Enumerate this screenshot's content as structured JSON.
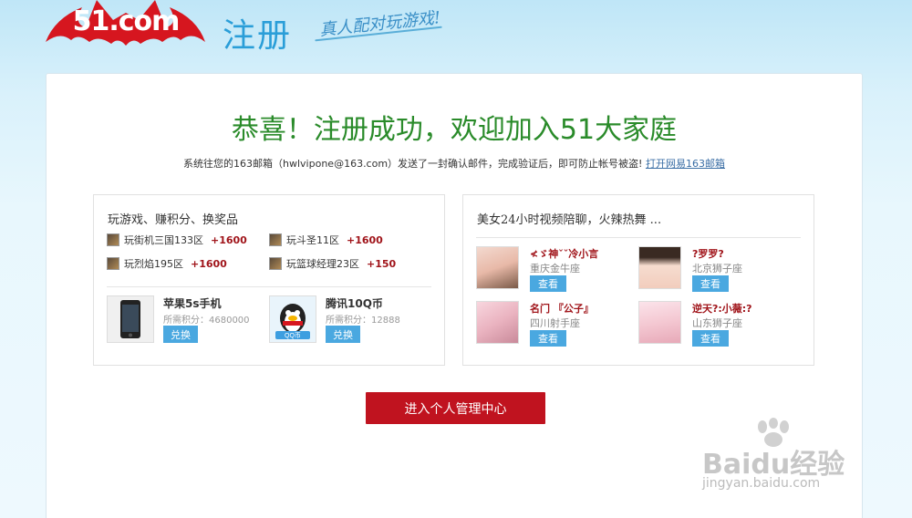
{
  "header": {
    "logo": "51.com",
    "register_title": "注册",
    "slogan": "真人配对玩游戏!"
  },
  "main": {
    "success_title": "恭喜！注册成功，欢迎加入51大家庭",
    "verify_text": "系统往您的163邮箱（hwlvipone@163.com）发送了一封确认邮件，完成验证后，即可防止帐号被盗!",
    "verify_link": "打开网易163邮箱"
  },
  "games_panel": {
    "title": "玩游戏、赚积分、换奖品",
    "games": [
      {
        "name": "玩街机三国133区",
        "points": "+1600"
      },
      {
        "name": "玩斗圣11区",
        "points": "+1600"
      },
      {
        "name": "玩烈焰195区",
        "points": "+1600"
      },
      {
        "name": "玩篮球经理23区",
        "points": "+150"
      }
    ],
    "prizes": [
      {
        "name": "苹果5s手机",
        "cost": "所需积分：4680000",
        "button": "兑换"
      },
      {
        "name": "腾讯10Q币",
        "cost": "所需积分：12888",
        "button": "兑换",
        "image_text": "QQ币"
      }
    ]
  },
  "video_panel": {
    "title": "美女24小时视频陪聊，火辣热舞 ...",
    "girls": [
      {
        "nick": "≮ゞ神ˇˇ冷小言",
        "location": "重庆金牛座",
        "button": "查看"
      },
      {
        "nick": "?罗罗?",
        "location": "北京狮子座",
        "button": "查看"
      },
      {
        "nick": "名门 『公子』",
        "location": "四川射手座",
        "button": "查看"
      },
      {
        "nick": "逆天?:小薇:?",
        "location": "山东狮子座",
        "button": "查看"
      }
    ]
  },
  "enter_button": "进入个人管理中心",
  "watermark": {
    "brand": "Baidu经验",
    "url": "jingyan.baidu.com"
  },
  "colors": {
    "success_green": "#2a8b2a",
    "brand_red": "#c0131f",
    "button_blue": "#4aa8e0",
    "points_red": "#a0141a"
  }
}
